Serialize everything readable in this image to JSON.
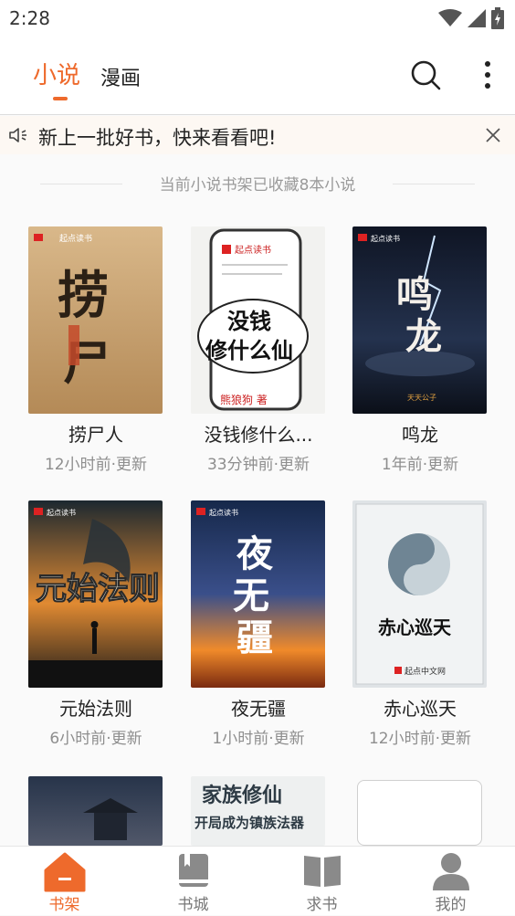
{
  "status_bar": {
    "time": "2:28"
  },
  "top_nav": {
    "tabs": [
      {
        "label": "小说",
        "active": true
      },
      {
        "label": "漫画",
        "active": false
      }
    ],
    "accent_color": "#ee6a2c"
  },
  "notice": {
    "text": "新上一批好书，快来看看吧!"
  },
  "shelf": {
    "count_text": "当前小说书架已收藏8本小说",
    "books": [
      {
        "title": "捞尸人",
        "update": "12小时前·更新",
        "cover_text": "捞尸人",
        "cover_badge": "起点读书"
      },
      {
        "title": "没钱修什么...",
        "update": "33分钟前·更新",
        "cover_text": "没钱修什么仙",
        "cover_author": "熊狼狗 著",
        "cover_badge": "起点读书"
      },
      {
        "title": "鸣龙",
        "update": "1年前·更新",
        "cover_text": "鸣龙",
        "cover_author": "天天公子",
        "cover_badge": "起点读书"
      },
      {
        "title": "元始法则",
        "update": "6小时前·更新",
        "cover_text": "元始法则",
        "cover_badge": "起点读书"
      },
      {
        "title": "夜无疆",
        "update": "1小时前·更新",
        "cover_text": "夜无疆",
        "cover_badge": "起点读书"
      },
      {
        "title": "赤心巡天",
        "update": "12小时前·更新",
        "cover_text": "赤心巡天",
        "cover_badge": "起点中文网"
      },
      {
        "title": "",
        "update": "",
        "cover_text": ""
      },
      {
        "title": "",
        "update": "",
        "cover_text": "家族修仙 开局成为镇族法器"
      },
      {
        "title": "",
        "update": "",
        "cover_text": ""
      }
    ]
  },
  "bottom_nav": {
    "items": [
      {
        "label": "书架",
        "active": true
      },
      {
        "label": "书城",
        "active": false
      },
      {
        "label": "求书",
        "active": false
      },
      {
        "label": "我的",
        "active": false
      }
    ]
  }
}
